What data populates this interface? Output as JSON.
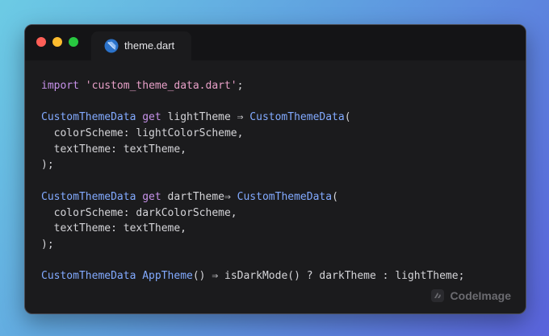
{
  "window": {
    "controls": {
      "close": "close-button",
      "minimize": "minimize-button",
      "maximize": "maximize-button"
    },
    "tab": {
      "label": "theme.dart",
      "icon": "dart-icon"
    }
  },
  "code": {
    "lines": [
      [
        {
          "t": "import",
          "c": "kw"
        },
        {
          "t": " ",
          "c": "pl"
        },
        {
          "t": "'custom_theme_data.dart'",
          "c": "str"
        },
        {
          "t": ";",
          "c": "pl"
        }
      ],
      [],
      [
        {
          "t": "CustomThemeData",
          "c": "ty"
        },
        {
          "t": " ",
          "c": "pl"
        },
        {
          "t": "get",
          "c": "kw"
        },
        {
          "t": " lightTheme ",
          "c": "pl"
        },
        {
          "t": "⇒",
          "c": "op"
        },
        {
          "t": " ",
          "c": "pl"
        },
        {
          "t": "CustomThemeData",
          "c": "ty"
        },
        {
          "t": "(",
          "c": "pl"
        }
      ],
      [
        {
          "t": "  colorScheme: lightColorScheme,",
          "c": "pl"
        }
      ],
      [
        {
          "t": "  textTheme: textTheme,",
          "c": "pl"
        }
      ],
      [
        {
          "t": ");",
          "c": "pl"
        }
      ],
      [],
      [
        {
          "t": "CustomThemeData",
          "c": "ty"
        },
        {
          "t": " ",
          "c": "pl"
        },
        {
          "t": "get",
          "c": "kw"
        },
        {
          "t": " dartTheme",
          "c": "pl"
        },
        {
          "t": "⇒",
          "c": "op"
        },
        {
          "t": " ",
          "c": "pl"
        },
        {
          "t": "CustomThemeData",
          "c": "ty"
        },
        {
          "t": "(",
          "c": "pl"
        }
      ],
      [
        {
          "t": "  colorScheme: darkColorScheme,",
          "c": "pl"
        }
      ],
      [
        {
          "t": "  textTheme: textTheme,",
          "c": "pl"
        }
      ],
      [
        {
          "t": ");",
          "c": "pl"
        }
      ],
      [],
      [
        {
          "t": "CustomThemeData",
          "c": "ty"
        },
        {
          "t": " ",
          "c": "pl"
        },
        {
          "t": "AppTheme",
          "c": "fn"
        },
        {
          "t": "() ",
          "c": "pl"
        },
        {
          "t": "⇒",
          "c": "op"
        },
        {
          "t": " isDarkMode() ? darkTheme : lightTheme;",
          "c": "pl"
        }
      ]
    ]
  },
  "watermark": {
    "label": "CodeImage",
    "icon": "codeimage-logo-icon"
  },
  "colors": {
    "keyword": "#c792ea",
    "string": "#e8a0c8",
    "type": "#82aaff",
    "plain": "#d4d4d8",
    "window_bg": "#1b1b1d"
  }
}
